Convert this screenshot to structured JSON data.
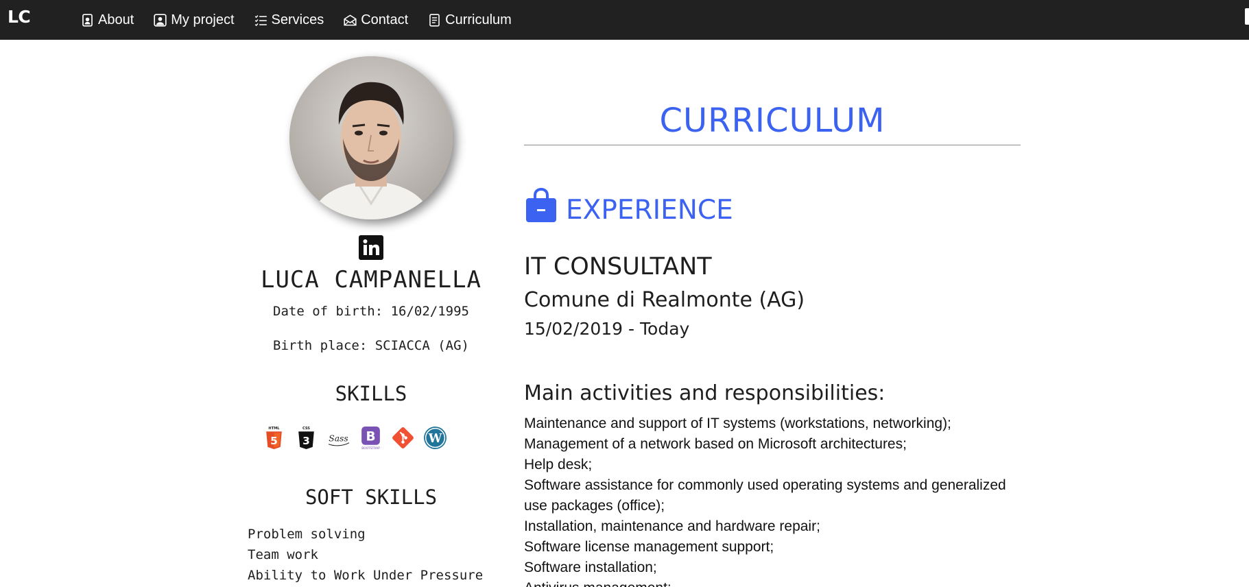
{
  "navbar": {
    "brand": "LC",
    "links": [
      {
        "label": "About",
        "icon": "person-badge-icon"
      },
      {
        "label": "My project",
        "icon": "person-square-icon"
      },
      {
        "label": "Services",
        "icon": "list-check-icon"
      },
      {
        "label": "Contact",
        "icon": "envelope-open-icon"
      },
      {
        "label": "Curriculum",
        "icon": "document-icon"
      }
    ]
  },
  "profile": {
    "name": "LUCA CAMPANELLA",
    "date_of_birth": "Date of birth: 16/02/1995",
    "birth_place": "Birth place: SCIACCA (AG)",
    "social_icon": "linkedin-icon"
  },
  "skills": {
    "title": "SKILLS",
    "icons": [
      "html5-icon",
      "css3-icon",
      "sass-icon",
      "bootstrap-icon",
      "git-icon",
      "wordpress-icon"
    ]
  },
  "soft_skills": {
    "title": "SOFT SKILLS",
    "items": [
      "Problem solving",
      "Team work",
      "Ability to Work Under Pressure"
    ]
  },
  "curriculum": {
    "title": "CURRICULUM",
    "section_title": "EXPERIENCE",
    "section_icon": "shopping-bag-icon",
    "job": {
      "title": "IT CONSULTANT",
      "company": "Comune di Realmonte (AG)",
      "period": "15/02/2019 - Today"
    },
    "activities_title": "Main activities and responsibilities:",
    "activities": [
      "Maintenance and support of IT systems (workstations, networking);",
      "Management of a network based on Microsoft architectures;",
      "Help desk;",
      "Software assistance for commonly used operating systems and generalized use packages (office);",
      "Installation, maintenance and hardware repair;",
      "Software license management support;",
      "Software installation;",
      "Antivirus management;"
    ]
  },
  "colors": {
    "navbar_bg": "#212121",
    "accent_blue": "#3b62f0",
    "text": "#1e1e1e"
  }
}
